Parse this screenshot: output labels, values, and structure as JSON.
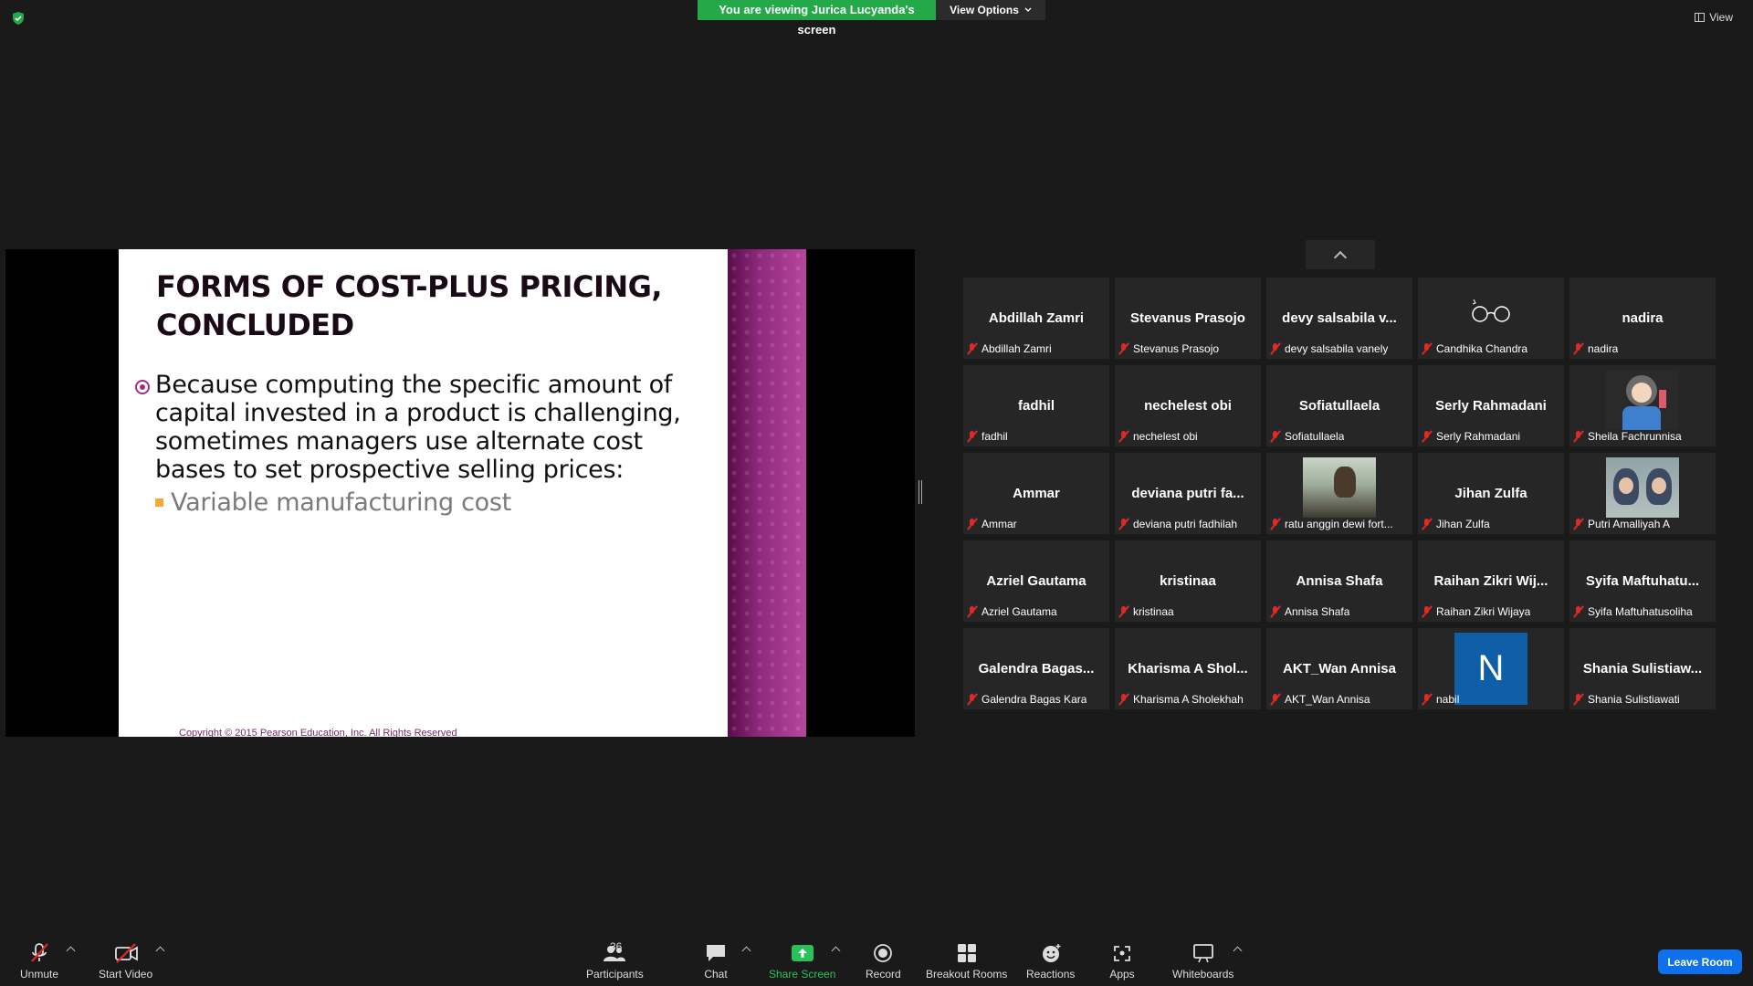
{
  "top": {
    "banner_text": "You are viewing Jurica Lucyanda's screen",
    "view_options": "View Options",
    "view_label": "View",
    "banner_color": "#23a947"
  },
  "slide": {
    "title": "FORMS OF COST-PLUS PRICING, CONCLUDED",
    "bullet": "Because computing the specific amount of capital invested in a product is challenging, sometimes managers use alternate cost bases to set prospective selling prices:",
    "sub_bullet": "Variable manufacturing cost",
    "copyright": "Copyright © 2015 Pearson Education, Inc. All Rights Reserved",
    "accent_color": "#9c2e8a"
  },
  "gallery": {
    "tiles": [
      {
        "display": "Abdillah Zamri",
        "name": "Abdillah Zamri",
        "media": "text"
      },
      {
        "display": "Stevanus Prasojo",
        "name": "Stevanus Prasojo",
        "media": "text"
      },
      {
        "display": "devy salsabila v...",
        "name": "devy salsabila vanely",
        "media": "text"
      },
      {
        "display": "",
        "name": "Candhika Chandra",
        "media": "glasses-icon"
      },
      {
        "display": "nadira",
        "name": "nadira",
        "media": "text"
      },
      {
        "display": "fadhil",
        "name": "fadhil",
        "media": "text"
      },
      {
        "display": "nechelest obi",
        "name": "nechelest obi",
        "media": "text"
      },
      {
        "display": "Sofiatullaela",
        "name": "Sofiatullaela",
        "media": "text"
      },
      {
        "display": "Serly Rahmadani",
        "name": "Serly Rahmadani",
        "media": "text"
      },
      {
        "display": "",
        "name": "Sheila Fachrunnisa",
        "media": "cartoon-photo"
      },
      {
        "display": "Ammar",
        "name": "Ammar",
        "media": "text"
      },
      {
        "display": "deviana putri fa...",
        "name": "deviana putri fadhilah",
        "media": "text"
      },
      {
        "display": "",
        "name": "ratu anggin dewi fort...",
        "media": "landscape-photo"
      },
      {
        "display": "Jihan Zulfa",
        "name": "Jihan Zulfa",
        "media": "text"
      },
      {
        "display": "",
        "name": "Putri Amalliyah A",
        "media": "selfie-photo"
      },
      {
        "display": "Azriel Gautama",
        "name": "Azriel Gautama",
        "media": "text"
      },
      {
        "display": "kristinaa",
        "name": "kristinaa",
        "media": "text"
      },
      {
        "display": "Annisa Shafa",
        "name": "Annisa Shafa",
        "media": "text"
      },
      {
        "display": "Raihan Zikri Wij...",
        "name": "Raihan Zikri Wijaya",
        "media": "text"
      },
      {
        "display": "Syifa Maftuhatu...",
        "name": "Syifa Maftuhatusoliha",
        "media": "text"
      },
      {
        "display": "Galendra Bagas...",
        "name": "Galendra Bagas Kara",
        "media": "text"
      },
      {
        "display": "Kharisma A Shol...",
        "name": "Kharisma A Sholekhah",
        "media": "text"
      },
      {
        "display": "AKT_Wan Annisa",
        "name": "AKT_Wan Annisa",
        "media": "text"
      },
      {
        "display": "N",
        "name": "nabil",
        "media": "letter-avatar"
      },
      {
        "display": "Shania Sulistiaw...",
        "name": "Shania Sulistiawati",
        "media": "text"
      }
    ]
  },
  "toolbar": {
    "unmute": "Unmute",
    "start_video": "Start Video",
    "participants": "Participants",
    "participant_count": "36",
    "chat": "Chat",
    "share_screen": "Share Screen",
    "record": "Record",
    "breakout_rooms": "Breakout Rooms",
    "reactions": "Reactions",
    "apps": "Apps",
    "whiteboards": "Whiteboards",
    "leave_room": "Leave Room",
    "leave_color": "#0e71eb",
    "share_color": "#29c15a"
  }
}
